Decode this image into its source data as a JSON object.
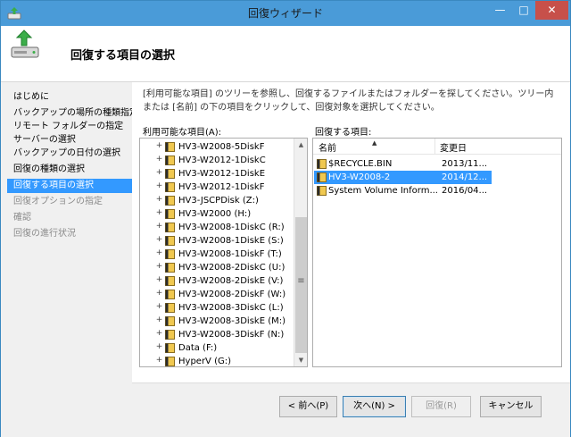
{
  "window": {
    "title": "回復ウィザード"
  },
  "titlebar_buttons": {
    "minimize": "—",
    "maximize": "□",
    "close": "✕"
  },
  "header": {
    "page_title": "回復する項目の選択"
  },
  "sidebar": {
    "steps": [
      {
        "label": "はじめに",
        "state": "done"
      },
      {
        "label": "バックアップの場所の種類指定",
        "state": "done"
      },
      {
        "label": "リモート フォルダーの指定",
        "state": "done"
      },
      {
        "label": "サーバーの選択",
        "state": "done"
      },
      {
        "label": "バックアップの日付の選択",
        "state": "done"
      },
      {
        "label": "回復の種類の選択",
        "state": "done"
      },
      {
        "label": "回復する項目の選択",
        "state": "current"
      },
      {
        "label": "回復オプションの指定",
        "state": "pending"
      },
      {
        "label": "確認",
        "state": "pending"
      },
      {
        "label": "回復の進行状況",
        "state": "pending"
      }
    ]
  },
  "content": {
    "instruction": "[利用可能な項目] のツリーを参照し、回復するファイルまたはフォルダーを探してください。ツリー内または [名前] の下の項目をクリックして、回復対象を選択してください。",
    "available_label": "利用可能な項目(A):",
    "restore_label": "回復する項目:"
  },
  "tree": {
    "items": [
      "HV3-W2008-5DiskF",
      "HV3-W2012-1DiskC",
      "HV3-W2012-1DiskE",
      "HV3-W2012-1DiskF",
      "HV3-JSCPDisk (Z:)",
      "HV3-W2000 (H:)",
      "HV3-W2008-1DiskC (R:)",
      "HV3-W2008-1DiskE (S:)",
      "HV3-W2008-1DiskF (T:)",
      "HV3-W2008-2DiskC (U:)",
      "HV3-W2008-2DiskE (V:)",
      "HV3-W2008-2DiskF (W:)",
      "HV3-W2008-3DiskC (L:)",
      "HV3-W2008-3DiskE (M:)",
      "HV3-W2008-3DiskF (N:)",
      "Data (F:)",
      "HyperV (G:)"
    ],
    "expander": "+",
    "scroll_up": "▲",
    "scroll_down": "▼",
    "grip": "≡"
  },
  "list": {
    "columns": {
      "name": "名前",
      "modified": "変更日"
    },
    "sort_indicator": "▲",
    "rows": [
      {
        "name": "$RECYCLE.BIN",
        "date": "2013/11...",
        "selected": false
      },
      {
        "name": "HV3-W2008-2",
        "date": "2014/12...",
        "selected": true
      },
      {
        "name": "System Volume Inform...",
        "date": "2016/04...",
        "selected": false
      }
    ]
  },
  "buttons": {
    "back": "< 前へ(P)",
    "next": "次へ(N) >",
    "restore": "回復(R)",
    "cancel": "キャンセル"
  },
  "colors": {
    "titlebar": "#4a9bd8",
    "selection": "#3399ff",
    "close": "#c7504a",
    "folder": "#f0c850"
  }
}
